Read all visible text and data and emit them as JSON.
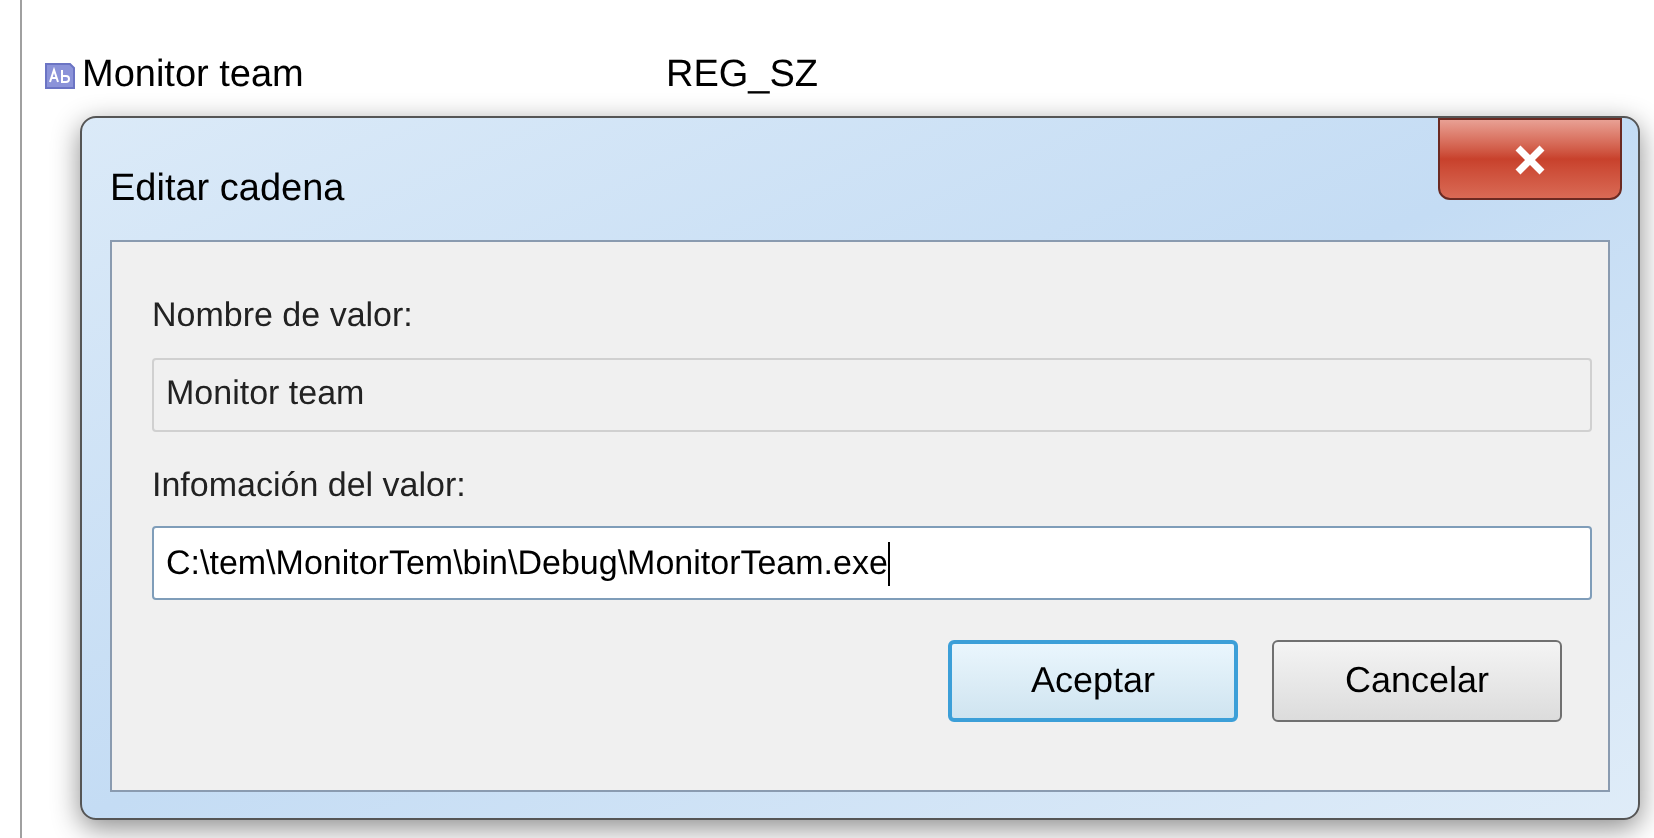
{
  "registry_row": {
    "name": "Monitor team",
    "type": "REG_SZ"
  },
  "dialog": {
    "title": "Editar cadena",
    "fields": [
      {
        "label": "Nombre de valor:",
        "value": "Monitor team",
        "read_only": true
      },
      {
        "label": "Infomación del valor:",
        "value": "C:\\tem\\MonitorTem\\bin\\Debug\\MonitorTeam.exe",
        "read_only": false
      }
    ],
    "buttons": [
      {
        "label": "Aceptar",
        "default": true
      },
      {
        "label": "Cancelar",
        "default": false
      }
    ]
  }
}
